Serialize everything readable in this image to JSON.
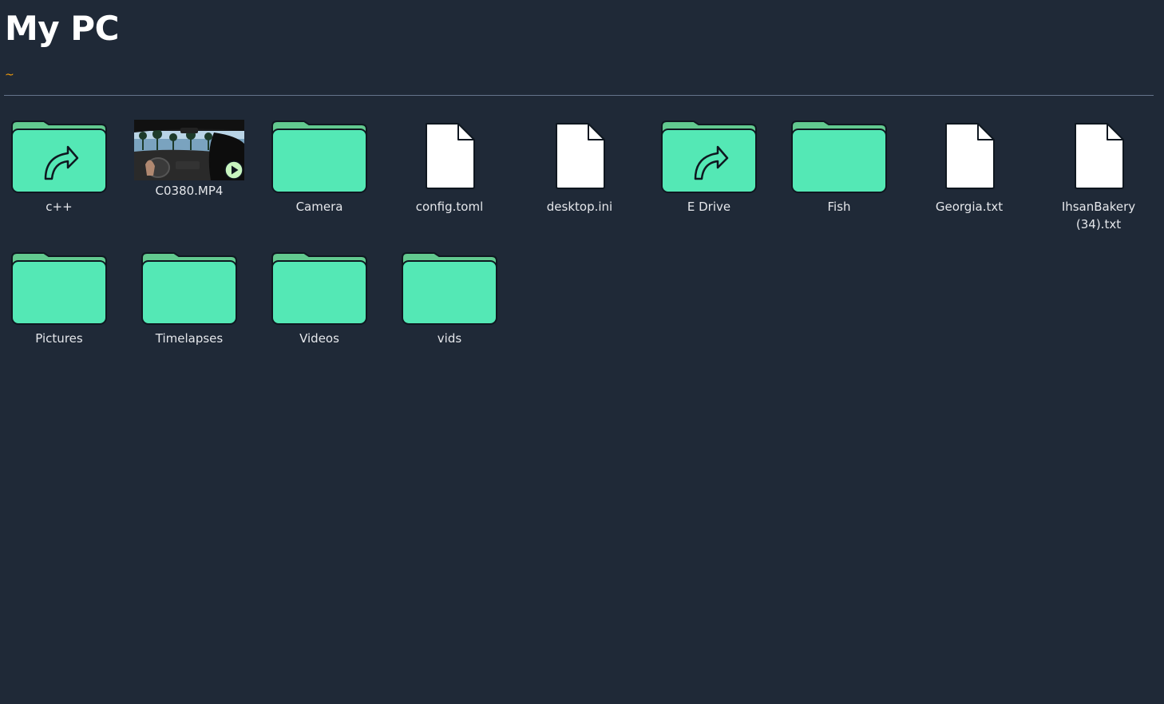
{
  "page": {
    "title": "My PC",
    "path": "~"
  },
  "items": [
    {
      "type": "shortcut",
      "label": "c++"
    },
    {
      "type": "video",
      "label": "C0380.MP4"
    },
    {
      "type": "folder",
      "label": "Camera"
    },
    {
      "type": "file",
      "label": "config.toml"
    },
    {
      "type": "file",
      "label": "desktop.ini"
    },
    {
      "type": "shortcut",
      "label": "E Drive"
    },
    {
      "type": "folder",
      "label": "Fish"
    },
    {
      "type": "file",
      "label": "Georgia.txt"
    },
    {
      "type": "file",
      "label": "IhsanBakery (34).txt"
    },
    {
      "type": "folder",
      "label": "Pictures"
    },
    {
      "type": "folder",
      "label": "Timelapses"
    },
    {
      "type": "folder",
      "label": "Videos"
    },
    {
      "type": "folder",
      "label": "vids"
    }
  ],
  "colors": {
    "background": "#1f2937",
    "folder": "#54e8b5",
    "folder_tab": "#62c98f",
    "path": "#f59e0b",
    "file": "#ffffff"
  }
}
